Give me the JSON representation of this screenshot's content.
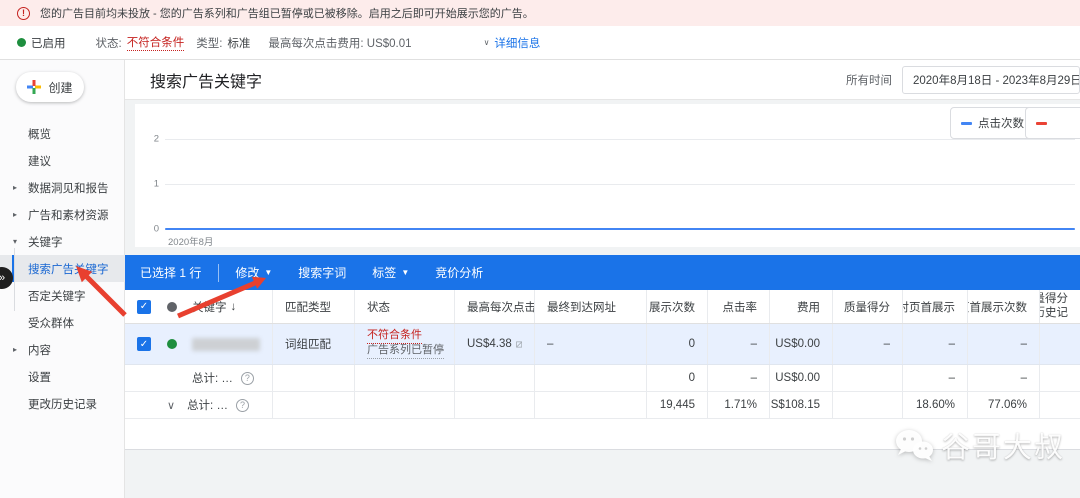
{
  "banner": {
    "text": "您的广告目前均未投放 - 您的广告系列和广告组已暂停或已被移除。启用之后即可开始展示您的广告。"
  },
  "status_bar": {
    "enabled": "已启用",
    "status_label": "状态:",
    "status_value": "不符合条件",
    "type_label": "类型:",
    "type_value": "标准",
    "max_cpc": "最高每次点击费用: US$0.01",
    "details_caret": "∨",
    "details": "详细信息"
  },
  "sidebar": {
    "create": "创建",
    "items": [
      {
        "label": "概览"
      },
      {
        "label": "建议"
      },
      {
        "label": "数据洞见和报告"
      },
      {
        "label": "广告和素材资源"
      },
      {
        "label": "关键字"
      },
      {
        "label": "搜索广告关键字"
      },
      {
        "label": "否定关键字"
      },
      {
        "label": "受众群体"
      },
      {
        "label": "内容"
      },
      {
        "label": "设置"
      },
      {
        "label": "更改历史记录"
      }
    ]
  },
  "header": {
    "title": "搜索广告关键字",
    "time_scope": "所有时间",
    "date_range": "2020年8月18日 - 2023年8月29日"
  },
  "chart_data": {
    "type": "line",
    "series": [
      {
        "name": "点击次数",
        "color": "#4285f4",
        "x": [
          "2020年8月"
        ],
        "values": [
          0
        ]
      }
    ],
    "yticks": [
      "2",
      "1",
      "0"
    ],
    "ylim": [
      0,
      2
    ],
    "xtick_labels": [
      "2020年8月"
    ],
    "legend_position": "top-right buttons",
    "grid": true,
    "note": "flat blue line at 0 clicks across entire date range"
  },
  "chart_controls": {
    "metric1": "点击次数",
    "metric1_color": "#4285f4",
    "metric2_color": "#ea4335"
  },
  "toolbar": {
    "selection": "已选择 1 行",
    "edit": "修改",
    "search_terms": "搜索字词",
    "labels": "标签",
    "auction_insights": "竞价分析"
  },
  "table": {
    "headers": {
      "keyword": "关键字",
      "sort_arrow": "↓",
      "match_type": "匹配类型",
      "status": "状态",
      "max_cpc": "最高每次点击费",
      "final_url": "最终到达网址",
      "impressions": "展示次数",
      "ctr": "点击率",
      "cost": "费用",
      "quality_score": "质量得分",
      "abs_top_impr": "绝对页首展示",
      "top_impr": "页首展示次数",
      "qs_hist_line1": "质量得分",
      "qs_hist_line2": "(历史记"
    },
    "row": {
      "match_type": "词组匹配",
      "status_line1": "不符合条件",
      "status_line2": "广告系列已暂停",
      "max_cpc": "US$4.38",
      "final_url": "–",
      "impressions": "0",
      "ctr": "–",
      "cost": "US$0.00",
      "quality_score": "–",
      "abs_top_impr": "–",
      "top_impr": "–"
    },
    "totals": [
      {
        "label": "总计: …",
        "impressions": "0",
        "ctr": "–",
        "cost": "US$0.00",
        "quality_score": "",
        "abs_top_impr": "–",
        "top_impr": "–"
      },
      {
        "label": "总计: …",
        "impressions": "19,445",
        "ctr": "1.71%",
        "cost": "US$108.15",
        "quality_score": "",
        "abs_top_impr": "18.60%",
        "top_impr": "77.06%"
      }
    ]
  },
  "watermark": {
    "text": "谷哥大叔"
  }
}
